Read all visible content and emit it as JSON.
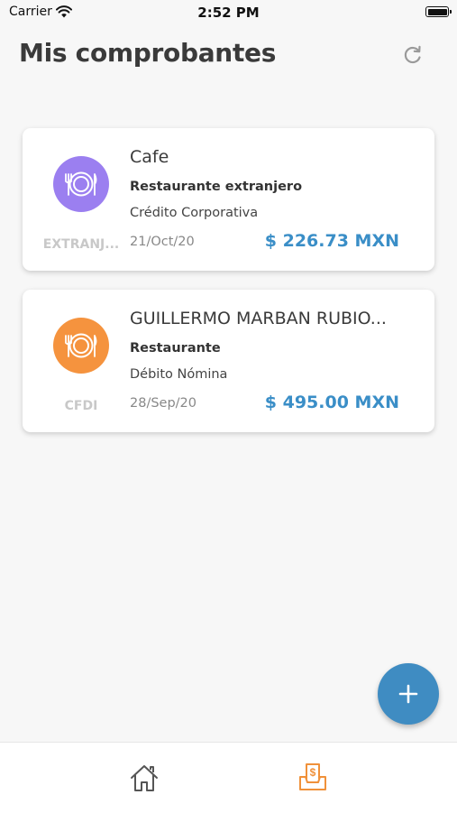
{
  "status_bar": {
    "carrier": "Carrier",
    "time": "2:52 PM"
  },
  "header": {
    "title": "Mis comprobantes",
    "refresh_icon": "refresh-icon"
  },
  "receipts": [
    {
      "merchant": "Cafe",
      "category": "Restaurante extranjero",
      "payment_method": "Crédito Corporativa",
      "date": "21/Oct/20",
      "amount": "$ 226.73 MXN",
      "type_label": "EXTRANJ...",
      "icon": "restaurant-icon",
      "icon_color": "#9b7ff0"
    },
    {
      "merchant": "GUILLERMO MARBAN RUBIO...",
      "category": "Restaurante",
      "payment_method": "Débito Nómina",
      "date": "28/Sep/20",
      "amount": "$ 495.00 MXN",
      "type_label": "CFDI",
      "icon": "restaurant-icon",
      "icon_color": "#f5933e"
    }
  ],
  "fab": {
    "icon": "plus-icon",
    "color": "#3f8cc2"
  },
  "bottom_nav": {
    "items": [
      {
        "icon": "home-icon",
        "active": false
      },
      {
        "icon": "receipt-icon",
        "active": true
      }
    ],
    "active_color": "#f0913a"
  },
  "colors": {
    "amount": "#3a8ec7",
    "background": "#f7f7f7"
  }
}
